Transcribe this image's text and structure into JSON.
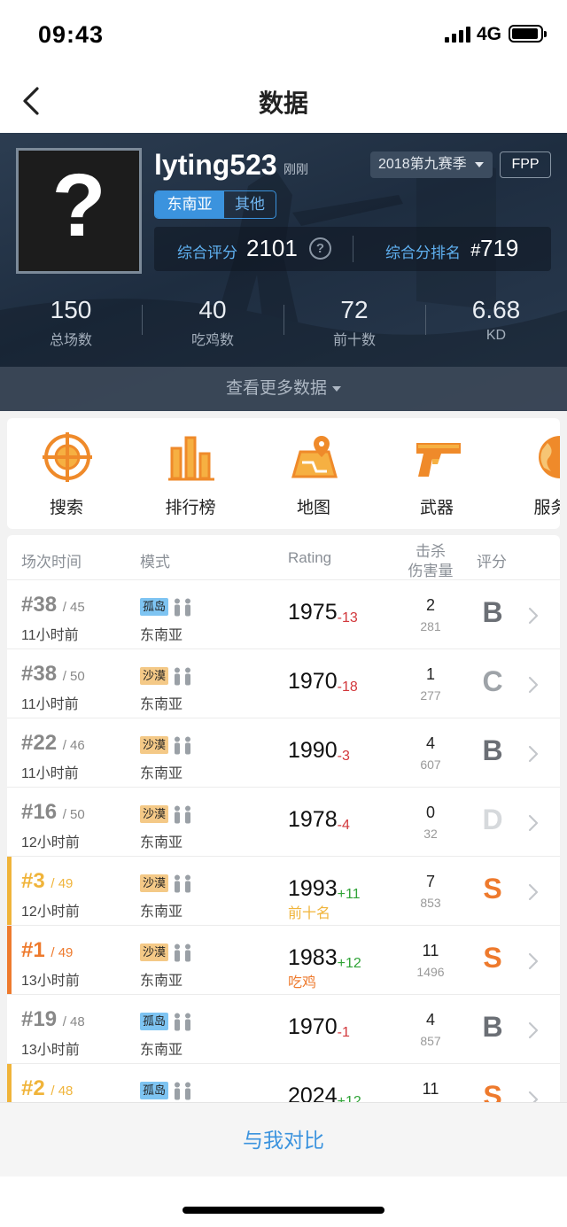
{
  "status": {
    "time": "09:43",
    "network": "4G"
  },
  "nav": {
    "title": "数据"
  },
  "profile": {
    "avatar_glyph": "?",
    "username": "lyting523",
    "updated": "刚刚",
    "season": "2018第九赛季",
    "mode": "FPP",
    "region_tabs": [
      "东南亚",
      "其他"
    ],
    "score_label": "综合评分",
    "score": "2101",
    "rank_label": "综合分排名",
    "rank": "719"
  },
  "stats": [
    {
      "value": "150",
      "label": "总场数"
    },
    {
      "value": "40",
      "label": "吃鸡数"
    },
    {
      "value": "72",
      "label": "前十数"
    },
    {
      "value": "6.68",
      "label": "KD"
    }
  ],
  "more_label": "查看更多数据",
  "menu": [
    {
      "label": "搜索",
      "icon": "crosshair-icon"
    },
    {
      "label": "排行榜",
      "icon": "bar-chart-icon"
    },
    {
      "label": "地图",
      "icon": "map-icon"
    },
    {
      "label": "武器",
      "icon": "pistol-icon"
    },
    {
      "label": "服务器",
      "icon": "globe-icon"
    }
  ],
  "table": {
    "headers": {
      "time": "场次时间",
      "mode": "模式",
      "rating": "Rating",
      "kills": "击杀",
      "damage": "伤害量",
      "grade": "评分"
    },
    "rows": [
      {
        "place": "#38",
        "total": "/ 45",
        "ago": "11小时前",
        "map": "孤岛",
        "region": "东南亚",
        "rating": "1975",
        "delta": "-13",
        "tag": "",
        "kills": "2",
        "damage": "281",
        "grade": "B"
      },
      {
        "place": "#38",
        "total": "/ 50",
        "ago": "11小时前",
        "map": "沙漠",
        "region": "东南亚",
        "rating": "1970",
        "delta": "-18",
        "tag": "",
        "kills": "1",
        "damage": "277",
        "grade": "C"
      },
      {
        "place": "#22",
        "total": "/ 46",
        "ago": "11小时前",
        "map": "沙漠",
        "region": "东南亚",
        "rating": "1990",
        "delta": "-3",
        "tag": "",
        "kills": "4",
        "damage": "607",
        "grade": "B"
      },
      {
        "place": "#16",
        "total": "/ 50",
        "ago": "12小时前",
        "map": "沙漠",
        "region": "东南亚",
        "rating": "1978",
        "delta": "-4",
        "tag": "",
        "kills": "0",
        "damage": "32",
        "grade": "D"
      },
      {
        "place": "#3",
        "total": "/ 49",
        "ago": "12小时前",
        "map": "沙漠",
        "region": "东南亚",
        "rating": "1993",
        "delta": "+11",
        "tag": "前十名",
        "kills": "7",
        "damage": "853",
        "grade": "S"
      },
      {
        "place": "#1",
        "total": "/ 49",
        "ago": "13小时前",
        "map": "沙漠",
        "region": "东南亚",
        "rating": "1983",
        "delta": "+12",
        "tag": "吃鸡",
        "kills": "11",
        "damage": "1496",
        "grade": "S"
      },
      {
        "place": "#19",
        "total": "/ 48",
        "ago": "13小时前",
        "map": "孤岛",
        "region": "东南亚",
        "rating": "1970",
        "delta": "-1",
        "tag": "",
        "kills": "4",
        "damage": "857",
        "grade": "B"
      },
      {
        "place": "#2",
        "total": "/ 48",
        "ago": "",
        "map": "孤岛",
        "region": "",
        "rating": "2024",
        "delta": "+12",
        "tag": "",
        "kills": "11",
        "damage": "",
        "grade": "S"
      }
    ]
  },
  "compare_label": "与我对比",
  "colors": {
    "accent": "#3b93de",
    "orange": "#ee7a2d",
    "gold": "#f0b43a",
    "grade_b": "#6b6f75",
    "grade_c": "#9ea3a8",
    "grade_d": "#d6d9dc"
  }
}
